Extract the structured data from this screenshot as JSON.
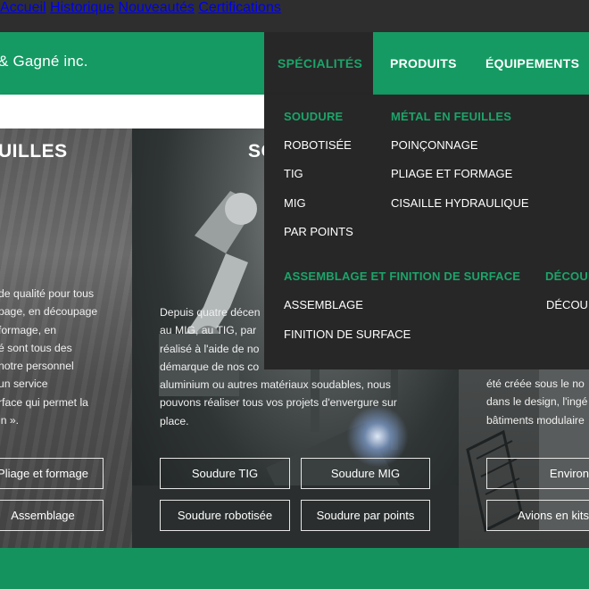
{
  "top_nav": [
    "Accueil",
    "Historique",
    "Nouveautés",
    "Certifications"
  ],
  "logo_text": "& Gagné inc.",
  "main_nav": [
    {
      "label": "SPÉCIALITÉS",
      "active": true
    },
    {
      "label": "PRODUITS",
      "active": false
    },
    {
      "label": "ÉQUIPEMENTS",
      "active": false
    }
  ],
  "dropdown": {
    "soudure": {
      "title": "SOUDURE",
      "items": [
        "ROBOTISÉE",
        "TIG",
        "MIG",
        "PAR POINTS"
      ]
    },
    "metal": {
      "title": "MÉTAL EN FEUILLES",
      "items": [
        "POINÇONNAGE",
        "PLIAGE ET FORMAGE",
        "CISAILLE HYDRAULIQUE"
      ]
    },
    "assemblage": {
      "title": "ASSEMBLAGE ET FINITION DE SURFACE",
      "items": [
        "ASSEMBLAGE",
        "FINITION DE SURFACE"
      ]
    },
    "decoupe": {
      "title": "DÉCOUP",
      "items": [
        "DÉCOUP"
      ]
    }
  },
  "columns": [
    {
      "heading": "UILLES",
      "paragraph": [
        "de qualité pour tous",
        "page, en découpage",
        "formage, en",
        "é sont tous des",
        "notre personnel",
        "un service",
        "rface qui permet la",
        "in »."
      ],
      "buttons": [
        "Pliage et formage",
        "Assemblage"
      ]
    },
    {
      "heading": "SO",
      "paragraph": [
        "Depuis quatre décen",
        "au MIG, au TIG, par",
        "réalisé à l'aide de no",
        "démarque de nos co",
        "aluminium ou autres matériaux soudables, nous",
        "pouvons réaliser tous vos projets d'envergure sur",
        "place."
      ],
      "buttons": [
        "Soudure TIG",
        "Soudure MIG",
        "Soudure robotisée",
        "Soudure par points"
      ]
    },
    {
      "heading": "",
      "paragraph": [
        "été créée sous le no",
        "dans le design, l'ingé",
        "bâtiments modulaire"
      ],
      "buttons": [
        "Environ",
        "Avions en kits"
      ]
    }
  ],
  "colors": {
    "brand_green": "#159a63",
    "menu_green_text": "#1ba56a",
    "dropdown_bg": "#272727",
    "topbar_bg": "#2e2e2e"
  }
}
